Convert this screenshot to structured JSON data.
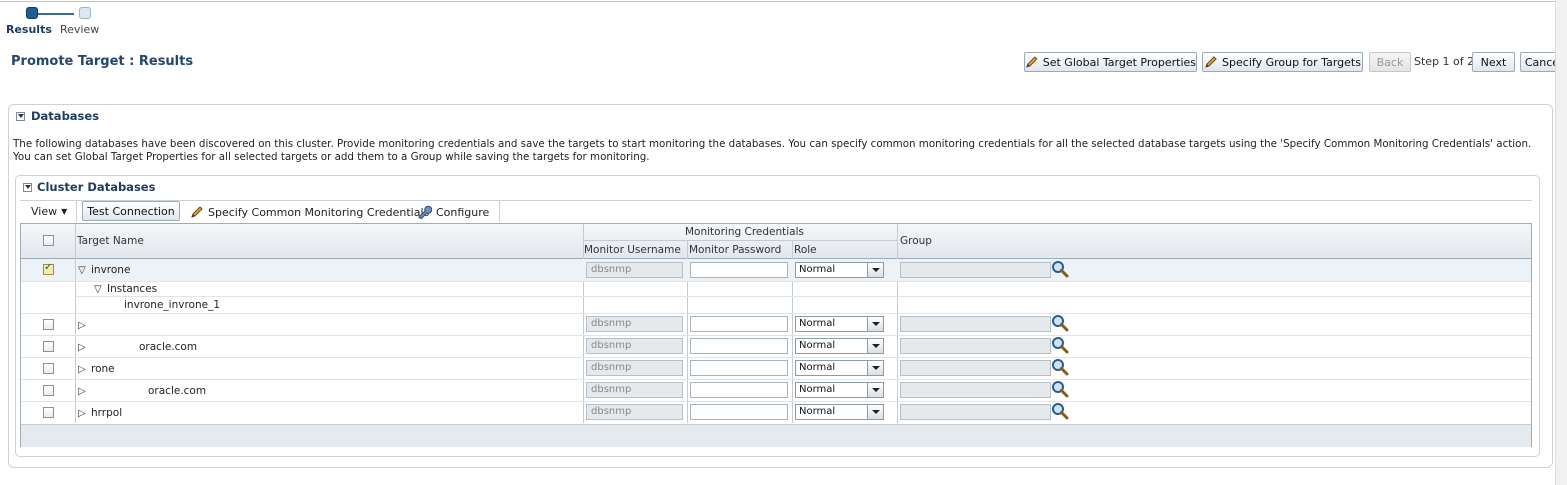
{
  "train": {
    "steps": [
      {
        "label": "Results",
        "active": true
      },
      {
        "label": "Review",
        "active": false
      }
    ]
  },
  "page_title": "Promote Target : Results",
  "header_buttons": {
    "set_global": "Set Global Target Properties",
    "specify_group": "Specify Group for Targets",
    "back": "Back",
    "step_text": "Step 1 of 2",
    "next": "Next",
    "cancel": "Cancel"
  },
  "databases": {
    "title": "Databases",
    "description": "The following databases have been discovered on this cluster. Provide monitoring credentials and save the targets to start monitoring the databases. You can specify common monitoring credentials for all the selected database targets using the 'Specify Common Monitoring Credentials' action. You can set Global Target Properties for all selected targets or add them to a Group while saving the targets for monitoring."
  },
  "cluster_databases": {
    "title": "Cluster Databases",
    "toolbar": {
      "view": "View",
      "test_connection": "Test Connection",
      "specify_common": "Specify Common Monitoring Credentials",
      "configure": "Configure"
    },
    "columns": {
      "target_name": "Target Name",
      "monitoring_credentials": "Monitoring Credentials",
      "monitor_username": "Monitor Username",
      "monitor_password": "Monitor Password",
      "role": "Role",
      "group": "Group"
    },
    "rows": [
      {
        "name": "invrone",
        "checked": true,
        "username": "dbsnmp",
        "role": "Normal"
      },
      {
        "instances_label": "Instances",
        "instance_name": "invrone_invrone_1"
      },
      {
        "name": "",
        "checked": false,
        "username": "dbsnmp",
        "role": "Normal"
      },
      {
        "name": "oracle.com",
        "checked": false,
        "username": "dbsnmp",
        "role": "Normal"
      },
      {
        "name": "rone",
        "checked": false,
        "username": "dbsnmp",
        "role": "Normal"
      },
      {
        "name": "oracle.com",
        "checked": false,
        "username": "dbsnmp",
        "role": "Normal"
      },
      {
        "name": "hrrpol",
        "checked": false,
        "username": "dbsnmp",
        "role": "Normal"
      }
    ]
  },
  "colors": {
    "title": "#24476d",
    "selected_row": "#edf2f6",
    "header_bg": "#e2e7ec"
  }
}
